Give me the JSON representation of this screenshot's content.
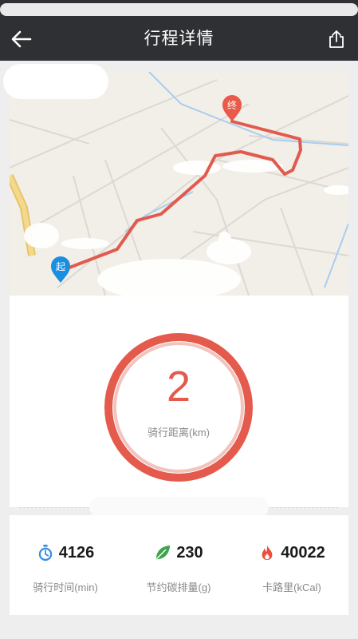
{
  "nav": {
    "title": "行程详情",
    "back_icon": "arrow-left-icon",
    "share_icon": "share-icon"
  },
  "map": {
    "start_label": "起",
    "end_label": "终",
    "route_color": "#e25a4e",
    "start_marker_color": "#1a8fe0",
    "end_marker_color": "#e85a4a"
  },
  "ride": {
    "distance_value": "2",
    "distance_label": "骑行距离(km)",
    "ring_color": "#e45a4c"
  },
  "stats": [
    {
      "value": "4126",
      "label": "骑行时间(min)",
      "icon": "stopwatch-icon",
      "icon_color": "#3a8ee6"
    },
    {
      "value": "230",
      "label": "节约碳排量(g)",
      "icon": "leaf-icon",
      "icon_color": "#3fa34d"
    },
    {
      "value": "40022",
      "label": "卡路里(kCal)",
      "icon": "flame-icon",
      "icon_color": "#ee4c3c"
    }
  ]
}
